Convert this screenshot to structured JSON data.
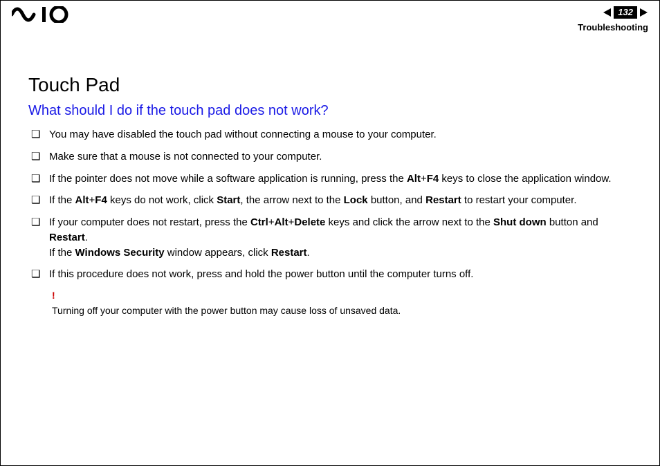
{
  "header": {
    "page_number": "132",
    "section": "Troubleshooting"
  },
  "content": {
    "h1": "Touch Pad",
    "h2": "What should I do if the touch pad does not work?",
    "items": [
      {
        "pre": "You may have disabled the touch pad without connecting a mouse to your computer."
      },
      {
        "pre": "Make sure that a mouse is not connected to your computer."
      },
      {
        "pre": "If the pointer does not move while a software application is running, press the ",
        "b1": "Alt",
        "mid1": "+",
        "b2": "F4",
        "post": " keys to close the application window."
      },
      {
        "pre": "If the ",
        "b1": "Alt",
        "mid1": "+",
        "b2": "F4",
        "mid2": " keys do not work, click ",
        "b3": "Start",
        "mid3": ", the arrow next to the ",
        "b4": "Lock",
        "mid4": " button, and ",
        "b5": "Restart",
        "post": " to restart your computer."
      },
      {
        "pre": "If your computer does not restart, press the ",
        "b1": "Ctrl",
        "mid1": "+",
        "b2": "Alt",
        "mid2": "+",
        "b3": "Delete",
        "mid3": " keys and click the arrow next to the ",
        "b4": "Shut down",
        "mid4": " button and ",
        "b5": "Restart",
        "post": ".",
        "line2_pre": "If the ",
        "line2_b1": "Windows Security",
        "line2_mid": " window appears, click ",
        "line2_b2": "Restart",
        "line2_post": "."
      },
      {
        "pre": "If this procedure does not work, press and hold the power button until the computer turns off."
      }
    ],
    "note": {
      "bang": "!",
      "text": "Turning off your computer with the power button may cause loss of unsaved data."
    }
  }
}
